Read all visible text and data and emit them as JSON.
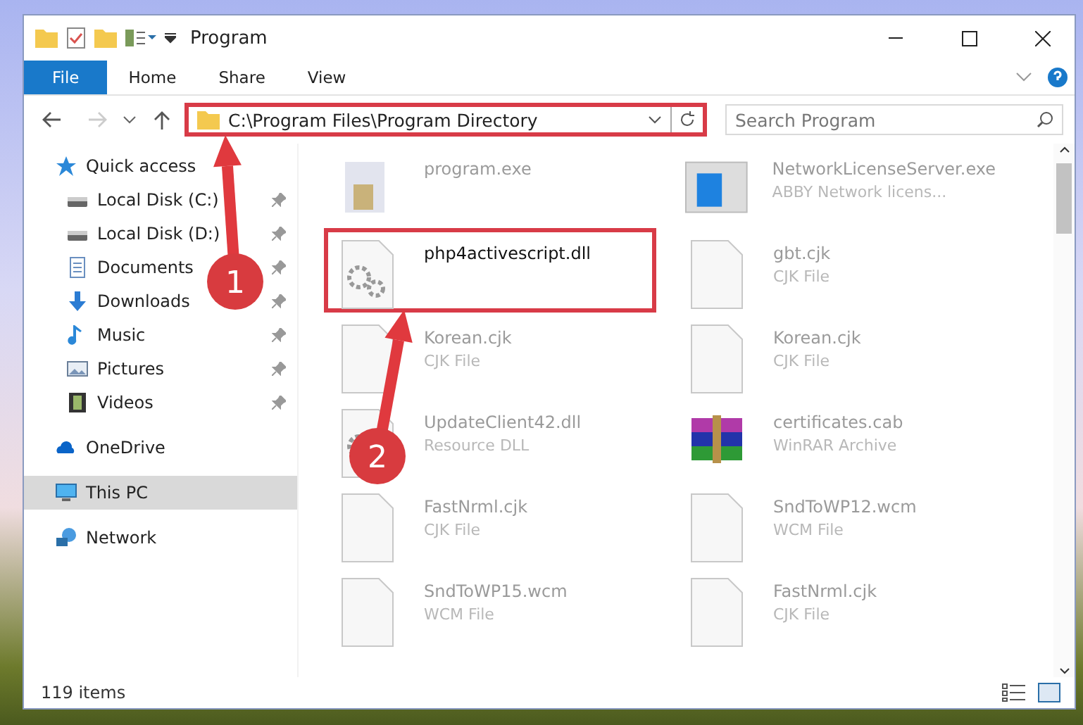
{
  "window": {
    "title": "Program"
  },
  "ribbon_tabs": [
    {
      "label": "File",
      "selected": true
    },
    {
      "label": "Home",
      "selected": false
    },
    {
      "label": "Share",
      "selected": false
    },
    {
      "label": "View",
      "selected": false
    }
  ],
  "address": {
    "path": "C:\\Program Files\\Program Directory",
    "highlighted": true
  },
  "search": {
    "placeholder": "Search Program"
  },
  "sidebar": {
    "items": [
      {
        "label": "Quick access",
        "kind": "group",
        "pinned": false,
        "selected": false
      },
      {
        "label": "Local Disk (C:)",
        "kind": "child",
        "pinned": true,
        "selected": false
      },
      {
        "label": "Local Disk (D:)",
        "kind": "child",
        "pinned": true,
        "selected": false
      },
      {
        "label": "Documents",
        "kind": "child",
        "pinned": true,
        "selected": false
      },
      {
        "label": "Downloads",
        "kind": "child",
        "pinned": true,
        "selected": false
      },
      {
        "label": "Music",
        "kind": "child",
        "pinned": true,
        "selected": false
      },
      {
        "label": "Pictures",
        "kind": "child",
        "pinned": true,
        "selected": false
      },
      {
        "label": "Videos",
        "kind": "child",
        "pinned": true,
        "selected": false
      },
      {
        "label": "OneDrive",
        "kind": "group",
        "pinned": false,
        "selected": false
      },
      {
        "label": "This PC",
        "kind": "group",
        "pinned": false,
        "selected": true
      },
      {
        "label": "Network",
        "kind": "group",
        "pinned": false,
        "selected": false
      }
    ]
  },
  "files": [
    {
      "name": "program.exe",
      "highlighted": false
    },
    {
      "name": "NetworkLicenseServer.exe",
      "type": "ABBY Network licens...",
      "highlighted": false
    },
    {
      "name": "php4activescript.dll",
      "highlighted": true
    },
    {
      "name": "gbt.cjk",
      "type": "CJK File",
      "highlighted": false
    },
    {
      "name": "Korean.cjk",
      "type": "CJK File",
      "highlighted": false
    },
    {
      "name": "Korean.cjk",
      "type": "CJK File",
      "highlighted": false
    },
    {
      "name": "UpdateClient42.dll",
      "type": "Resource DLL",
      "highlighted": false
    },
    {
      "name": "certificates.cab",
      "type": "WinRAR Archive",
      "highlighted": false
    },
    {
      "name": "FastNrml.cjk",
      "type": "CJK File",
      "highlighted": false
    },
    {
      "name": "SndToWP12.wcm",
      "type": "WCM File",
      "highlighted": false
    },
    {
      "name": "SndToWP15.wcm",
      "type": "WCM File",
      "highlighted": false
    },
    {
      "name": "FastNrml.cjk",
      "type": "CJK File",
      "highlighted": false
    }
  ],
  "status_bar": {
    "count": "119 items"
  },
  "annotations": [
    {
      "number": "1"
    },
    {
      "number": "2"
    }
  ]
}
